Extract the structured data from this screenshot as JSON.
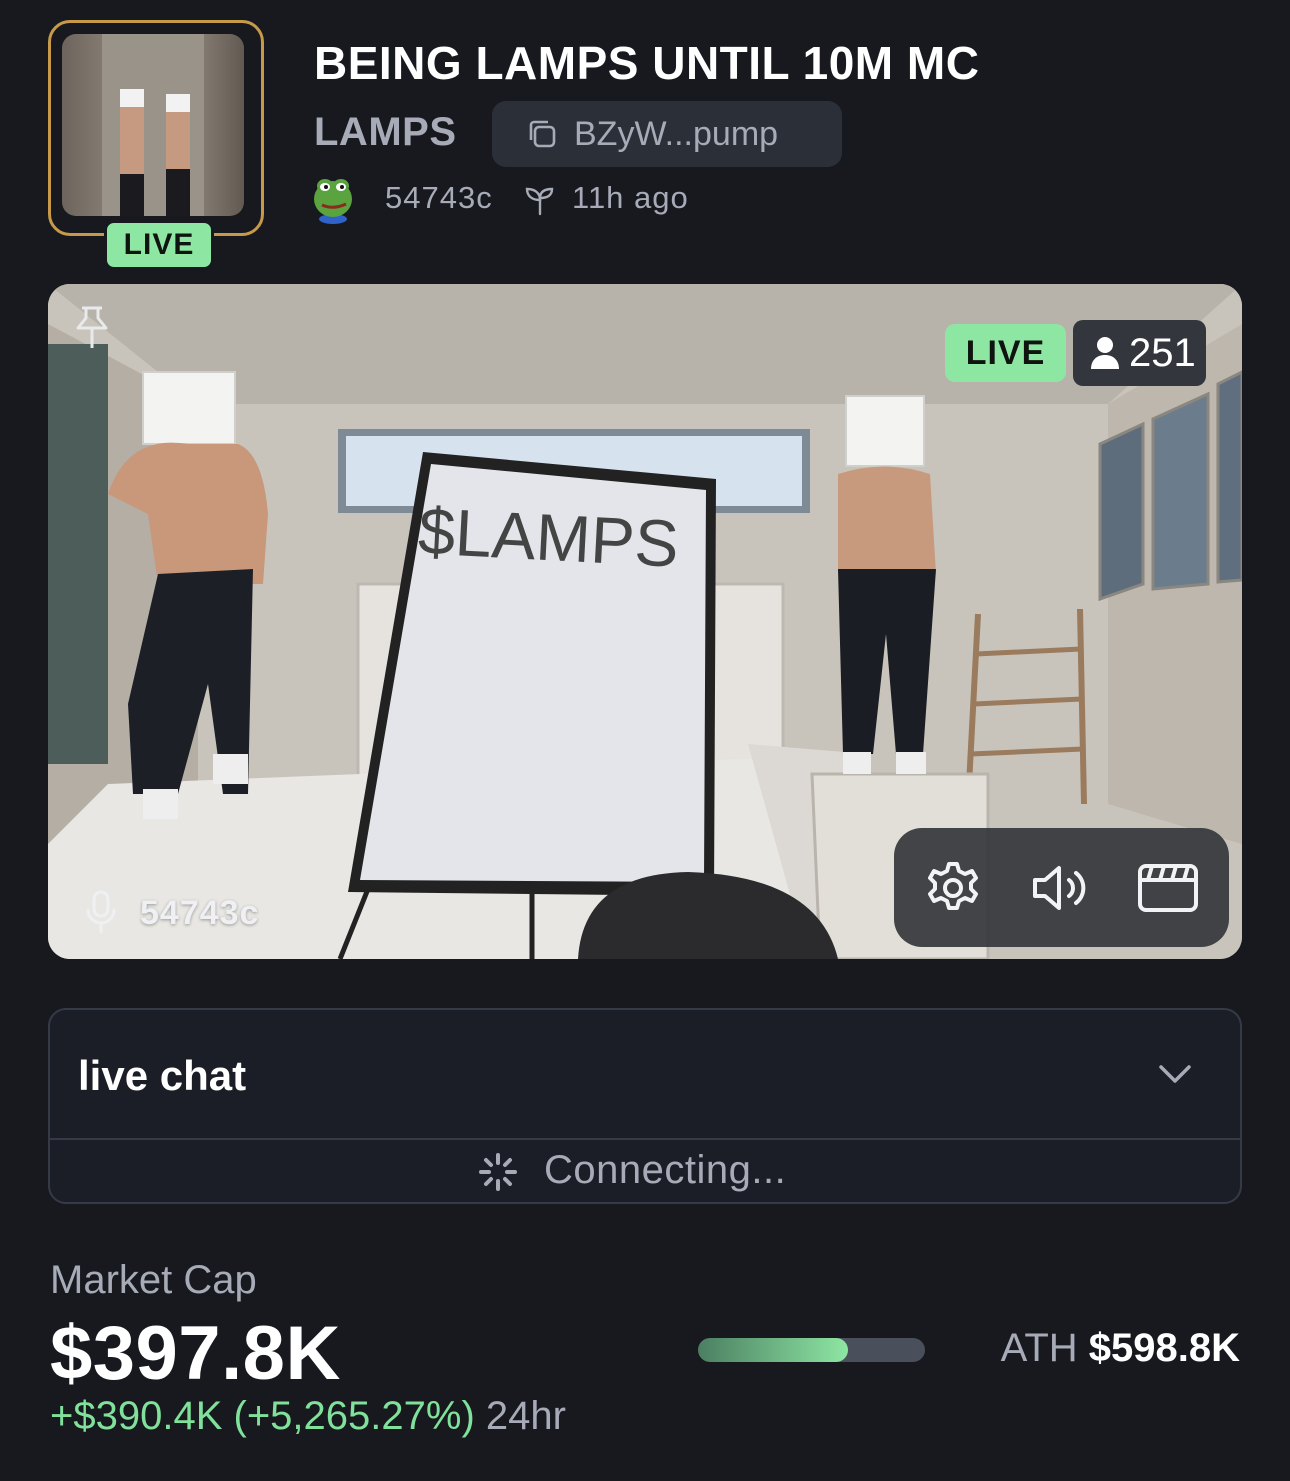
{
  "header": {
    "title": "BEING LAMPS UNTIL 10M MC",
    "ticker": "LAMPS",
    "contract_short": "BZyW...pump",
    "creator": "54743c",
    "created_ago": "11h ago",
    "thumbnail_badge": "LIVE",
    "thumbnail_border_color": "#c79a4a"
  },
  "video": {
    "live_label": "LIVE",
    "viewer_count": "251",
    "speaker": "54743c",
    "whiteboard_text": "$LAMPS",
    "controls": [
      "gear-icon",
      "volume-icon",
      "clapperboard-icon"
    ]
  },
  "chat": {
    "title": "live chat",
    "status": "Connecting..."
  },
  "market": {
    "label": "Market Cap",
    "value": "$397.8K",
    "change": "+$390.4K (+5,265.27%)",
    "period": "24hr",
    "ath_label": "ATH",
    "ath_value": "$598.8K",
    "ath_progress": 0.66,
    "accent_color": "#8ee6a3"
  }
}
